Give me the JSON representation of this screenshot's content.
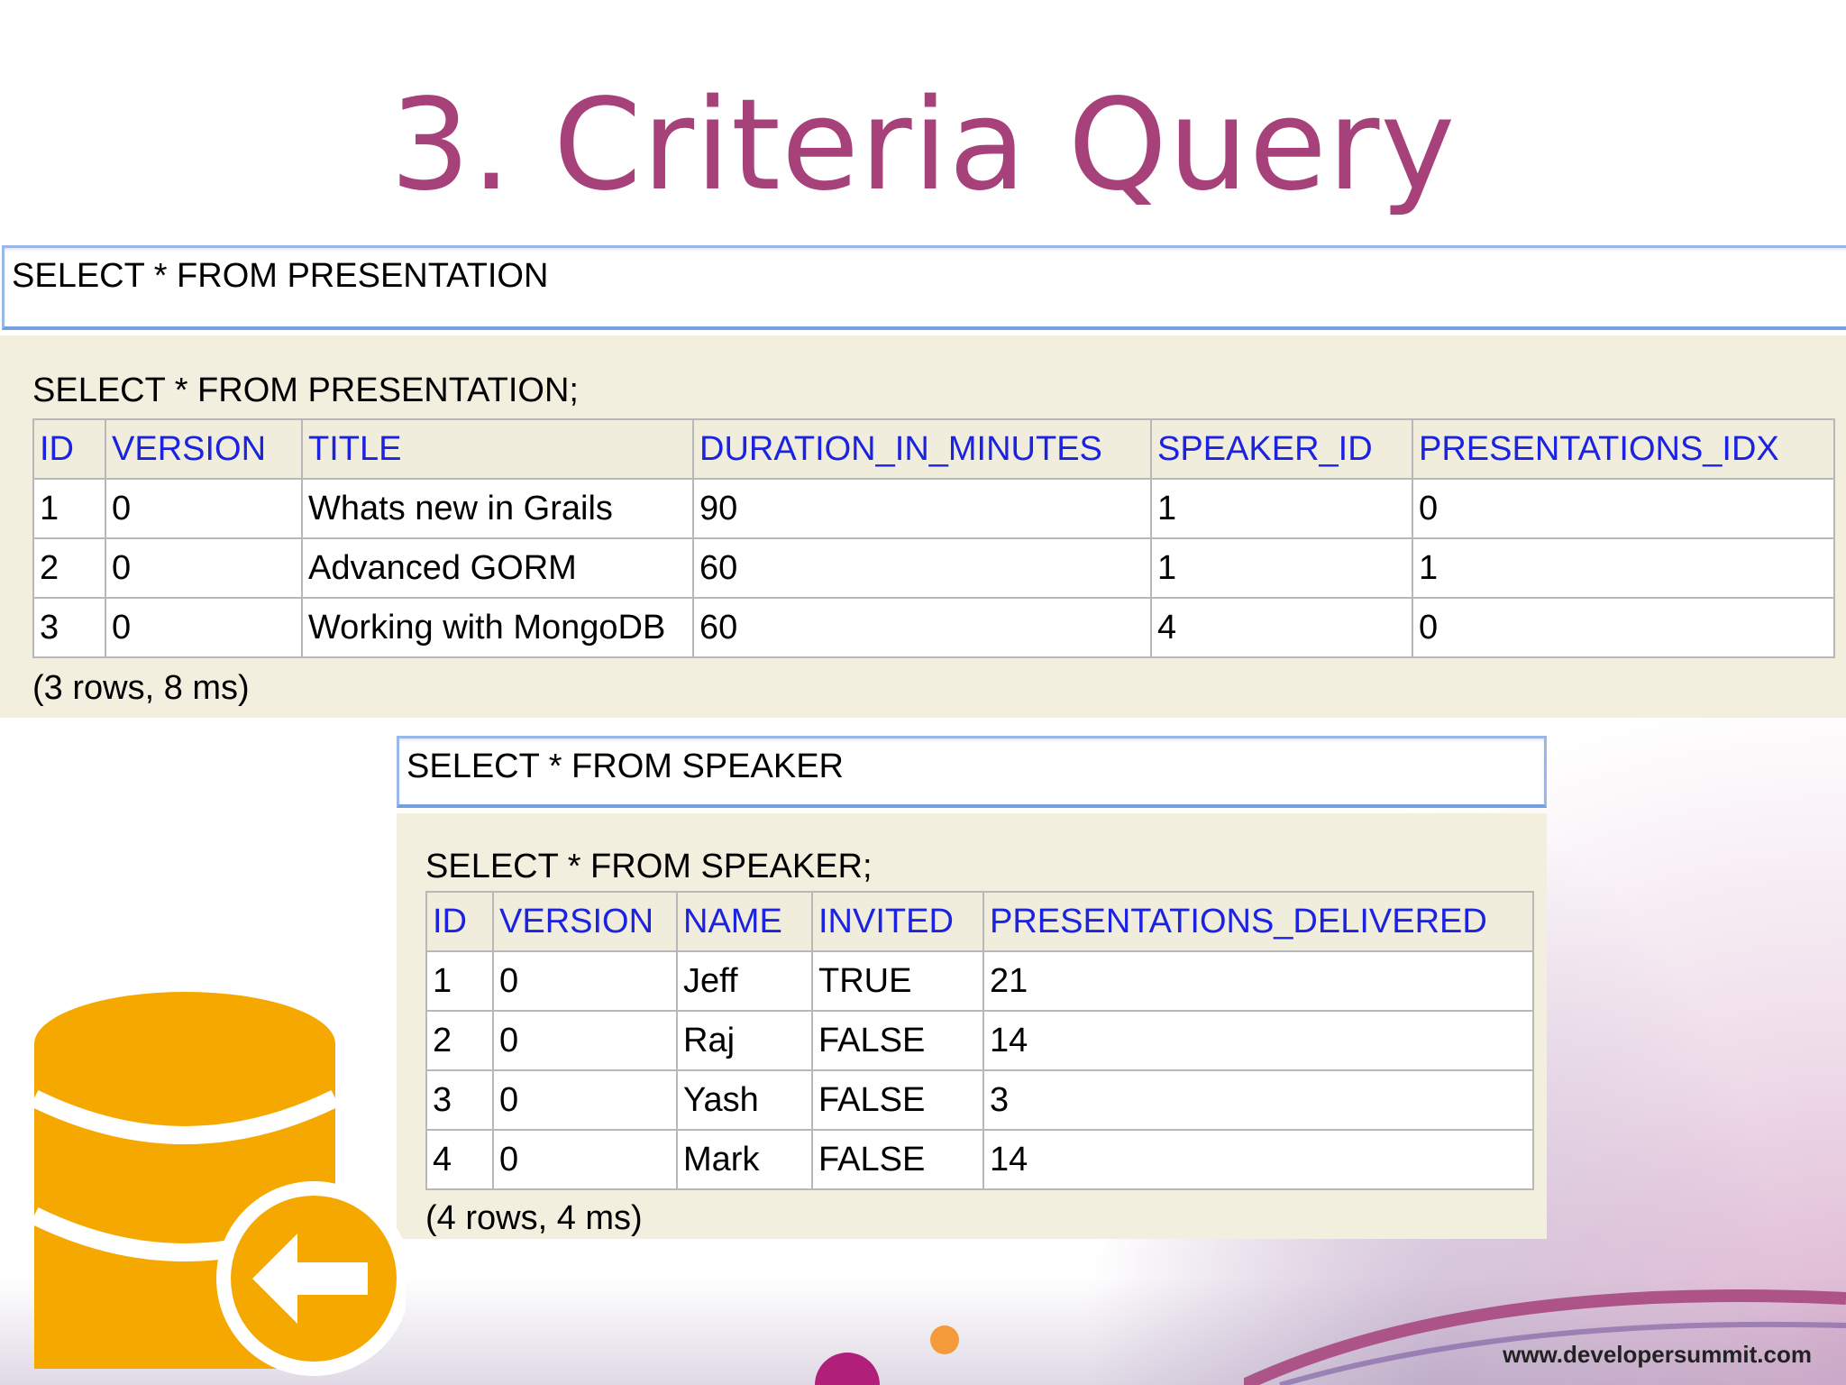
{
  "title": "3. Criteria Query",
  "colors": {
    "title": "#a6417a",
    "header_text": "#1b22e0",
    "panel_bg": "#f3efdf",
    "icon": "#f5a800"
  },
  "presentation": {
    "query_input": "SELECT * FROM PRESENTATION",
    "sql": "SELECT * FROM PRESENTATION;",
    "columns": [
      "ID",
      "VERSION",
      "TITLE",
      "DURATION_IN_MINUTES",
      "SPEAKER_ID",
      "PRESENTATIONS_IDX"
    ],
    "rows": [
      [
        "1",
        "0",
        "Whats new in Grails",
        "90",
        "1",
        "0"
      ],
      [
        "2",
        "0",
        "Advanced GORM",
        "60",
        "1",
        "1"
      ],
      [
        "3",
        "0",
        "Working with MongoDB",
        "60",
        "4",
        "0"
      ]
    ],
    "footer": "(3 rows, 8 ms)"
  },
  "speaker": {
    "query_input": "SELECT * FROM SPEAKER",
    "sql": "SELECT * FROM SPEAKER;",
    "columns": [
      "ID",
      "VERSION",
      "NAME",
      "INVITED",
      "PRESENTATIONS_DELIVERED"
    ],
    "rows": [
      [
        "1",
        "0",
        "Jeff",
        "TRUE",
        "21"
      ],
      [
        "2",
        "0",
        "Raj",
        "FALSE",
        "14"
      ],
      [
        "3",
        "0",
        "Yash",
        "FALSE",
        "3"
      ],
      [
        "4",
        "0",
        "Mark",
        "FALSE",
        "14"
      ]
    ],
    "footer": "(4 rows, 4 ms)"
  },
  "branding": {
    "url": "www.developersummit.com",
    "icon_name": "database-arrow-left-icon"
  }
}
